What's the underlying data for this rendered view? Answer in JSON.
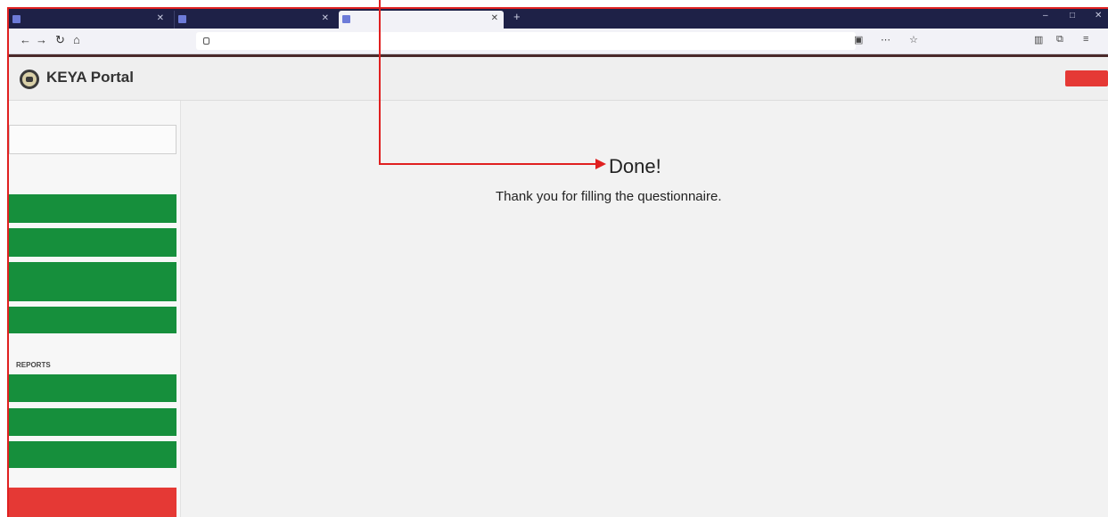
{
  "browser": {
    "tabs": [
      {
        "label": "",
        "active": false
      },
      {
        "label": "",
        "active": false
      },
      {
        "label": "",
        "active": true
      }
    ],
    "new_tab": "+",
    "window_controls": [
      "–",
      "□",
      "✕"
    ],
    "nav": {
      "back": "←",
      "forward": "→",
      "reload": "↻",
      "home": "⌂"
    },
    "url": "",
    "toolbar_icons": [
      "▣",
      "⋯",
      "☆"
    ],
    "right_icons": [
      "▥",
      "⧉",
      "≡"
    ]
  },
  "app": {
    "brand": "KEYA Portal",
    "logout_label": "",
    "school_label": ""
  },
  "sidebar": {
    "sections": [
      "",
      "",
      "REPORTS",
      ""
    ],
    "white_button": "",
    "action_buttons": [
      "",
      "",
      "",
      ""
    ],
    "report_buttons": [
      "",
      "",
      ""
    ],
    "red_button": ""
  },
  "main": {
    "title": "Done!",
    "message": "Thank you for filling the questionnaire."
  },
  "colors": {
    "accent_green": "#168f3c",
    "accent_red": "#e53935",
    "annotation_red": "#e02020",
    "tabbar": "#1e2147"
  }
}
